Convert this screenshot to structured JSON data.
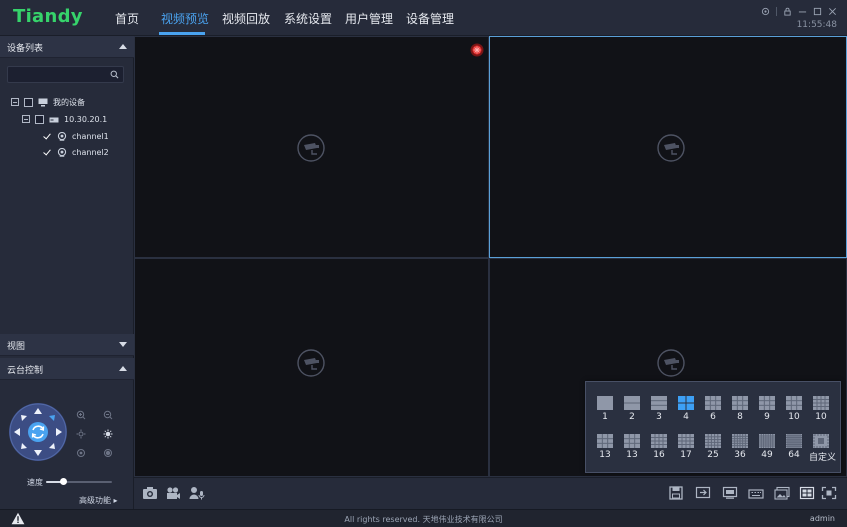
{
  "app": {
    "logo": "Tiandy"
  },
  "nav": {
    "items": [
      {
        "label": "首页",
        "active": false
      },
      {
        "label": "视频预览",
        "active": true
      },
      {
        "label": "视频回放",
        "active": false
      },
      {
        "label": "系统设置",
        "active": false
      },
      {
        "label": "用户管理",
        "active": false
      },
      {
        "label": "设备管理",
        "active": false
      }
    ]
  },
  "titlebar": {
    "time": "11:55:48",
    "icons": [
      "gear-icon",
      "lock-icon",
      "minimize-icon",
      "restore-icon",
      "close-icon"
    ]
  },
  "sidebar": {
    "device_list_title": "设备列表",
    "search": {
      "value": "",
      "placeholder": ""
    },
    "tree": {
      "root": {
        "label": "我的设备",
        "checked": false,
        "expanded": true
      },
      "device": {
        "label": "10.30.20.1",
        "checked": false,
        "expanded": true
      },
      "channels": [
        {
          "label": "channel1",
          "checked": true
        },
        {
          "label": "channel2",
          "checked": true
        }
      ]
    },
    "view_title": "视图",
    "ptz_title": "云台控制",
    "ptz": {
      "speed_label": "速度",
      "speed_value": 0.25,
      "advanced_label": "高级功能 ▸"
    }
  },
  "video": {
    "cells": [
      {
        "recording": true,
        "selected": false
      },
      {
        "recording": false,
        "selected": true
      },
      {
        "recording": false,
        "selected": false
      },
      {
        "recording": false,
        "selected": false
      }
    ]
  },
  "layout_popup": {
    "row1": [
      "1",
      "2",
      "3",
      "4",
      "6",
      "8",
      "9",
      "10",
      "10"
    ],
    "row2": [
      "13",
      "13",
      "16",
      "17",
      "25",
      "36",
      "49",
      "64",
      "自定义"
    ],
    "selected": "4"
  },
  "toolbar": {
    "left_icons": [
      "snapshot-icon",
      "record-icon",
      "talk-icon"
    ],
    "right_icons": [
      "save-icon",
      "export-icon",
      "display-icon",
      "keyboard-icon",
      "image-icon",
      "layout-icon",
      "fullscreen-icon"
    ]
  },
  "status": {
    "copyright": "All rights reserved. 天地伟业技术有限公司",
    "user": "admin"
  },
  "colors": {
    "accent": "#4aa3f0",
    "logo": "#36d36b",
    "recording": "#e53030"
  }
}
